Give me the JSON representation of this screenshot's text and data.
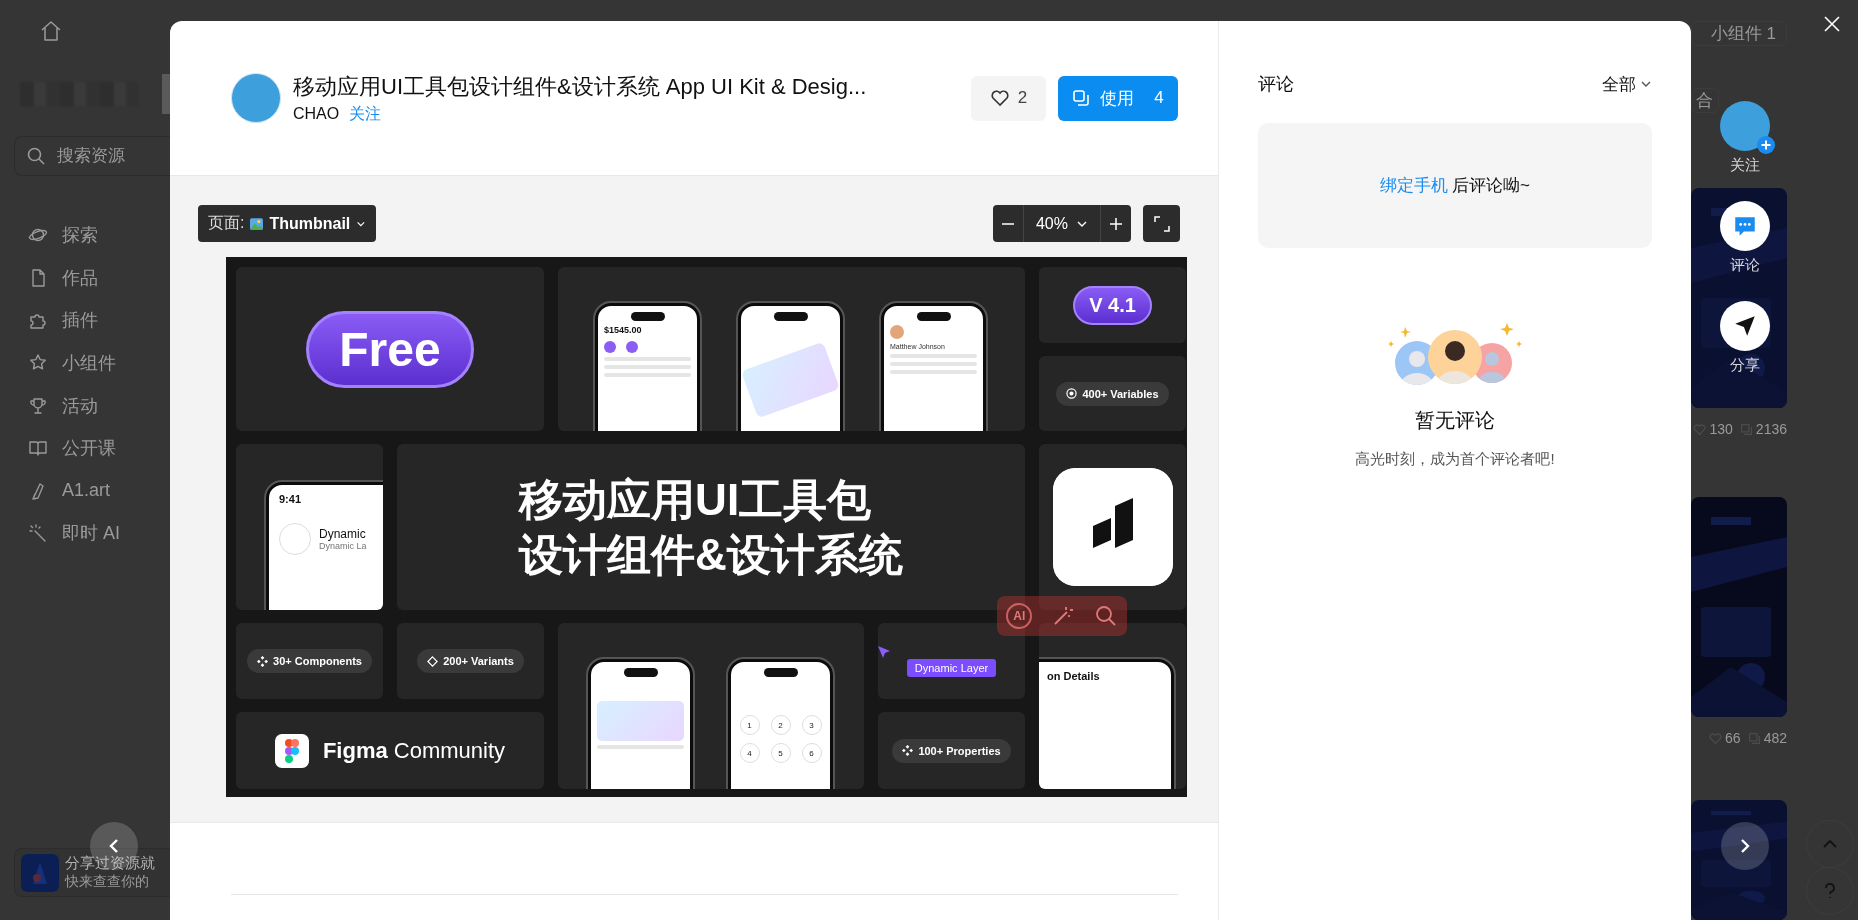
{
  "sidebar": {
    "search": {
      "placeholder": "搜索资源"
    },
    "items": [
      {
        "kind": "explore",
        "label": "探索"
      },
      {
        "kind": "works",
        "label": "作品"
      },
      {
        "kind": "plugins",
        "label": "插件"
      },
      {
        "kind": "widgets",
        "label": "小组件"
      },
      {
        "kind": "events",
        "label": "活动"
      },
      {
        "kind": "courses",
        "label": "公开课"
      },
      {
        "kind": "art",
        "label": "A1.art"
      },
      {
        "kind": "ai",
        "label": "即时 AI"
      }
    ],
    "promo": {
      "title": "分享过资源就",
      "subtitle": "快来查查你的"
    }
  },
  "background": {
    "widget_button": "小组件 1",
    "sort_button": "合",
    "cards": [
      {
        "kind": "picture",
        "likes": "130",
        "copies": "2136"
      },
      {
        "kind": "picture",
        "likes": "66",
        "copies": "482"
      },
      {
        "kind": "picture"
      }
    ]
  },
  "modal": {
    "title": "移动应用UI工具包设计组件&设计系统 App UI Kit & Desig...",
    "author": "CHAO",
    "follow": "关注",
    "likes": "2",
    "use_button": {
      "label": "使用",
      "count": "4"
    },
    "toolbar": {
      "page_label": "页面:",
      "page_name": "Thumbnail",
      "zoom": "40%"
    },
    "thumbnail": {
      "free_badge": "Free",
      "version_badge": "V 4.1",
      "stat_pills": [
        {
          "kind": "variables",
          "label": "400+ Variables"
        },
        {
          "kind": "components",
          "label": "30+ Components"
        },
        {
          "kind": "variants",
          "label": "200+ Variants"
        },
        {
          "kind": "properties",
          "label": "100+ Properties"
        }
      ],
      "headline": [
        "移动应用UI工具包",
        "设计组件&设计系统"
      ],
      "brand": "**Figma** Community",
      "layer_tag": "Dynamic Layer",
      "ai_label": "AI",
      "phones": {
        "balance": "$1545.00",
        "profile_name": "Matthew Johnson",
        "time": "9:41",
        "item_title": "Dynamic",
        "item_subtitle": "Dynamic La",
        "detail_title": "on Details",
        "keypad": [
          "1",
          "2",
          "3",
          "4",
          "5",
          "6"
        ]
      }
    }
  },
  "comments": {
    "title": "评论",
    "filter": "全部",
    "prompt_link": "绑定手机",
    "prompt_text": "后评论呦~",
    "empty_title": "暂无评论",
    "empty_hint": "高光时刻，成为首个评论者吧!"
  },
  "actions": [
    {
      "kind": "follow",
      "label": "关注"
    },
    {
      "kind": "comment",
      "label": "评论"
    },
    {
      "kind": "share",
      "label": "分享"
    }
  ]
}
